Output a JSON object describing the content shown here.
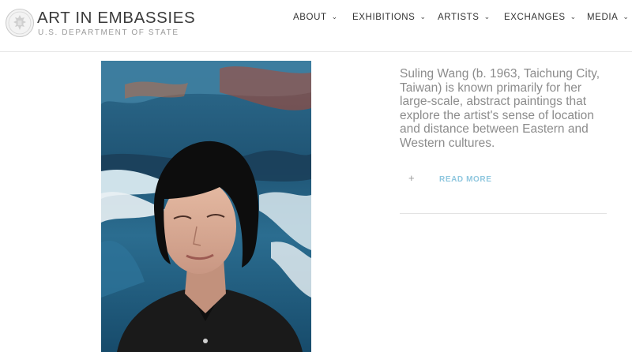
{
  "brand": {
    "title": "ART IN EMBASSIES",
    "subtitle": "U.S. DEPARTMENT OF STATE"
  },
  "nav": {
    "items": [
      {
        "label": "ABOUT"
      },
      {
        "label": "EXHIBITIONS"
      },
      {
        "label": "ARTISTS"
      },
      {
        "label": "EXCHANGES"
      },
      {
        "label": "MEDIA"
      }
    ]
  },
  "artist": {
    "bio": "Suling Wang (b. 1963, Taichung City, Taiwan) is known primarily for her large-scale, abstract paintings that explore the artist's sense of location and distance between Eastern and Western cultures.",
    "read_more_icon": "+",
    "read_more_label": "READ MORE"
  },
  "colors": {
    "accent_link": "#8fc7df",
    "body_text": "#8c8c8c"
  }
}
